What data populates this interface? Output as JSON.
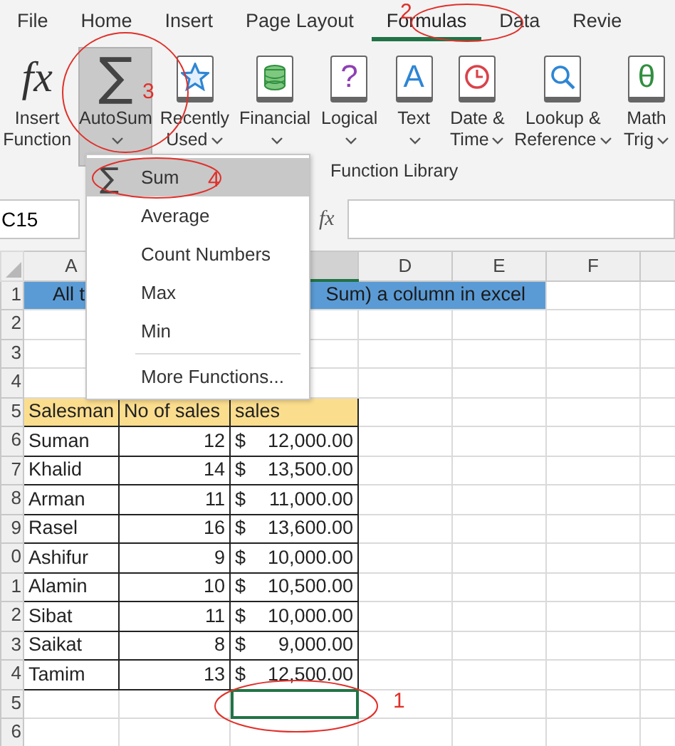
{
  "ribbon_tabs": [
    {
      "label": "File",
      "selected": false
    },
    {
      "label": "Home",
      "selected": false
    },
    {
      "label": "Insert",
      "selected": false
    },
    {
      "label": "Page Layout",
      "selected": false
    },
    {
      "label": "Formulas",
      "selected": true
    },
    {
      "label": "Data",
      "selected": false
    },
    {
      "label": "Revie",
      "selected": false
    }
  ],
  "ribbon_buttons": [
    {
      "lines": [
        "Insert",
        "Function"
      ],
      "kind": "fx",
      "glyph": "fx",
      "dropdown": false,
      "pressed": false
    },
    {
      "lines": [
        "AutoSum"
      ],
      "kind": "sigma",
      "glyph": "∑",
      "dropdown": true,
      "pressed": true
    },
    {
      "lines": [
        "Recently",
        "Used"
      ],
      "kind": "star",
      "dropdown": true,
      "pressed": false
    },
    {
      "lines": [
        "Financial"
      ],
      "kind": "database",
      "dropdown": true,
      "pressed": false
    },
    {
      "lines": [
        "Logical"
      ],
      "kind": "question",
      "glyph": "?",
      "dropdown": true,
      "pressed": false
    },
    {
      "lines": [
        "Text"
      ],
      "kind": "letter",
      "glyph": "A",
      "dropdown": true,
      "pressed": false
    },
    {
      "lines": [
        "Date &",
        "Time"
      ],
      "kind": "clock",
      "dropdown": true,
      "pressed": false
    },
    {
      "lines": [
        "Lookup &",
        "Reference"
      ],
      "kind": "magnifier",
      "dropdown": true,
      "pressed": false
    },
    {
      "lines": [
        "Math",
        "Trig"
      ],
      "kind": "theta",
      "glyph": "θ",
      "dropdown": true,
      "pressed": false
    }
  ],
  "ribbon_group": "Function Library",
  "formula_bar": {
    "name_box": "C15",
    "fx": "fx"
  },
  "columns": [
    {
      "label": "A",
      "selected": false
    },
    {},
    {
      "selected": true
    },
    {
      "label": "D",
      "selected": false
    },
    {
      "label": "E",
      "selected": false
    },
    {
      "label": "F",
      "selected": false
    },
    {
      "selected": false
    }
  ],
  "rows": [
    {
      "number": "1",
      "kind": "title",
      "parts": [
        "All t",
        "Sum) a column in excel"
      ],
      "selected": false
    },
    {
      "number": "2",
      "kind": "blank",
      "selected": false
    },
    {
      "number": "3",
      "kind": "blank",
      "selected": false
    },
    {
      "number": "4",
      "kind": "blank",
      "selected": false
    },
    {
      "number": "5",
      "kind": "header",
      "cells": [
        "Salesman",
        "No of sales",
        "sales"
      ],
      "selected": false
    },
    {
      "number": "6",
      "kind": "data",
      "cells": [
        "Suman",
        "12",
        "$",
        "12,000.00"
      ],
      "selected": false
    },
    {
      "number": "7",
      "kind": "data",
      "cells": [
        "Khalid",
        "14",
        "$",
        "13,500.00"
      ],
      "selected": false
    },
    {
      "number": "8",
      "kind": "data",
      "cells": [
        "Arman",
        "11",
        "$",
        "11,000.00"
      ],
      "selected": false
    },
    {
      "number": "9",
      "kind": "data",
      "cells": [
        "Rasel",
        "16",
        "$",
        "13,600.00"
      ],
      "selected": false
    },
    {
      "number": "0",
      "kind": "data",
      "cells": [
        "Ashifur",
        "9",
        "$",
        "10,000.00"
      ],
      "selected": false
    },
    {
      "number": "1",
      "kind": "data",
      "cells": [
        "Alamin",
        "10",
        "$",
        "10,500.00"
      ],
      "selected": false
    },
    {
      "number": "2",
      "kind": "data",
      "cells": [
        "Sibat",
        "11",
        "$",
        "10,000.00"
      ],
      "selected": false
    },
    {
      "number": "3",
      "kind": "data",
      "cells": [
        "Saikat",
        "8",
        "$",
        "9,000.00"
      ],
      "selected": false
    },
    {
      "number": "4",
      "kind": "data",
      "cells": [
        "Tamim",
        "13",
        "$",
        "12,500.00"
      ],
      "selected": false
    },
    {
      "number": "5",
      "kind": "blank",
      "selected": true
    },
    {
      "number": "6",
      "kind": "blank",
      "selected": false
    }
  ],
  "menu": {
    "items": [
      {
        "label": "Sum",
        "glyph": "∑",
        "selected": true
      },
      {
        "label": "Average",
        "selected": false
      },
      {
        "label": "Count Numbers",
        "selected": false
      },
      {
        "label": "Max",
        "selected": false
      },
      {
        "label": "Min",
        "selected": false
      }
    ],
    "footer_items": [
      {
        "label": "More Functions...",
        "selected": false
      }
    ]
  },
  "annotations": [
    {
      "label": "2"
    },
    {
      "label": "3"
    },
    {
      "label": "4"
    },
    {
      "label": "1"
    }
  ]
}
